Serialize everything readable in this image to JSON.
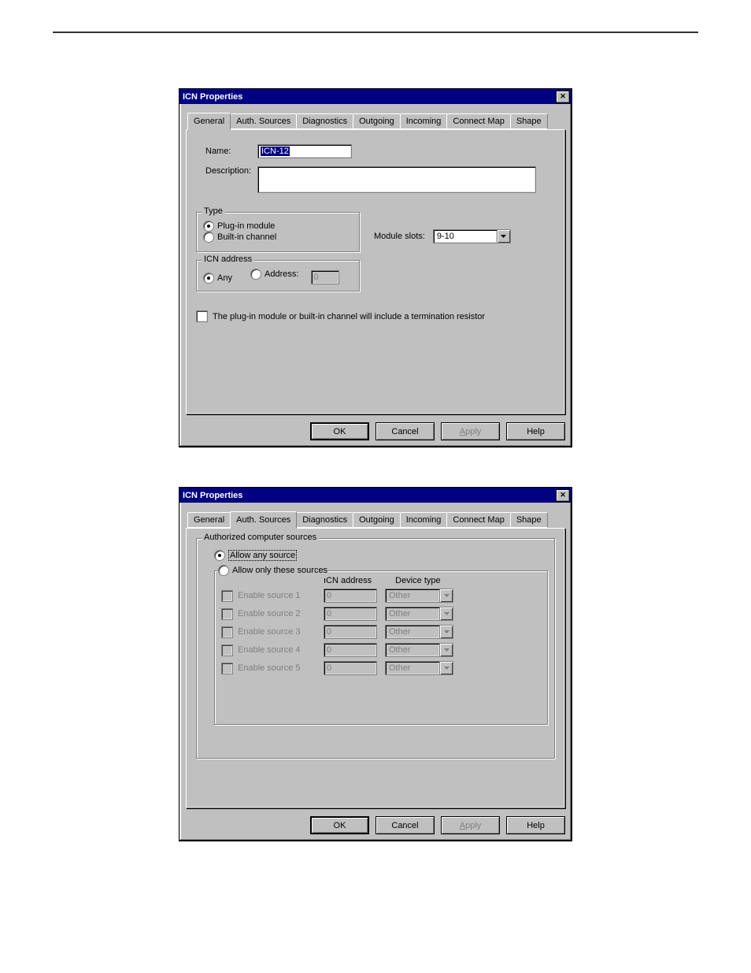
{
  "tabs": [
    "General",
    "Auth. Sources",
    "Diagnostics",
    "Outgoing",
    "Incoming",
    "Connect Map",
    "Shape"
  ],
  "buttons": {
    "ok": "OK",
    "cancel": "Cancel",
    "apply": "Apply",
    "help": "Help"
  },
  "dlg1": {
    "title": "ICN Properties",
    "active_tab": "General",
    "name_label": "Name:",
    "name_value": "ICN-12",
    "desc_label": "Description:",
    "desc_value": "",
    "type_legend": "Type",
    "type_plugin": "Plug-in module",
    "type_builtin": "Built-in channel",
    "type_selected": "plugin",
    "module_slots_label": "Module slots:",
    "module_slots_value": "9-10",
    "icn_legend": "ICN address",
    "icn_any": "Any",
    "icn_addr": "Address:",
    "icn_addr_value": "0",
    "icn_selected": "any",
    "term_label": "The plug-in module or built-in channel will include a termination resistor"
  },
  "dlg2": {
    "title": "ICN Properties",
    "active_tab": "Auth. Sources",
    "group_legend": "Authorized computer sources",
    "allow_any": "Allow any source",
    "allow_only": "Allow only these sources",
    "selected": "any",
    "col_addr": "ICN address",
    "col_type": "Device type",
    "sources": [
      {
        "enable": "Enable source 1",
        "addr": "0",
        "type": "Other"
      },
      {
        "enable": "Enable source 2",
        "addr": "0",
        "type": "Other"
      },
      {
        "enable": "Enable source 3",
        "addr": "0",
        "type": "Other"
      },
      {
        "enable": "Enable source 4",
        "addr": "0",
        "type": "Other"
      },
      {
        "enable": "Enable source 5",
        "addr": "0",
        "type": "Other"
      }
    ]
  }
}
